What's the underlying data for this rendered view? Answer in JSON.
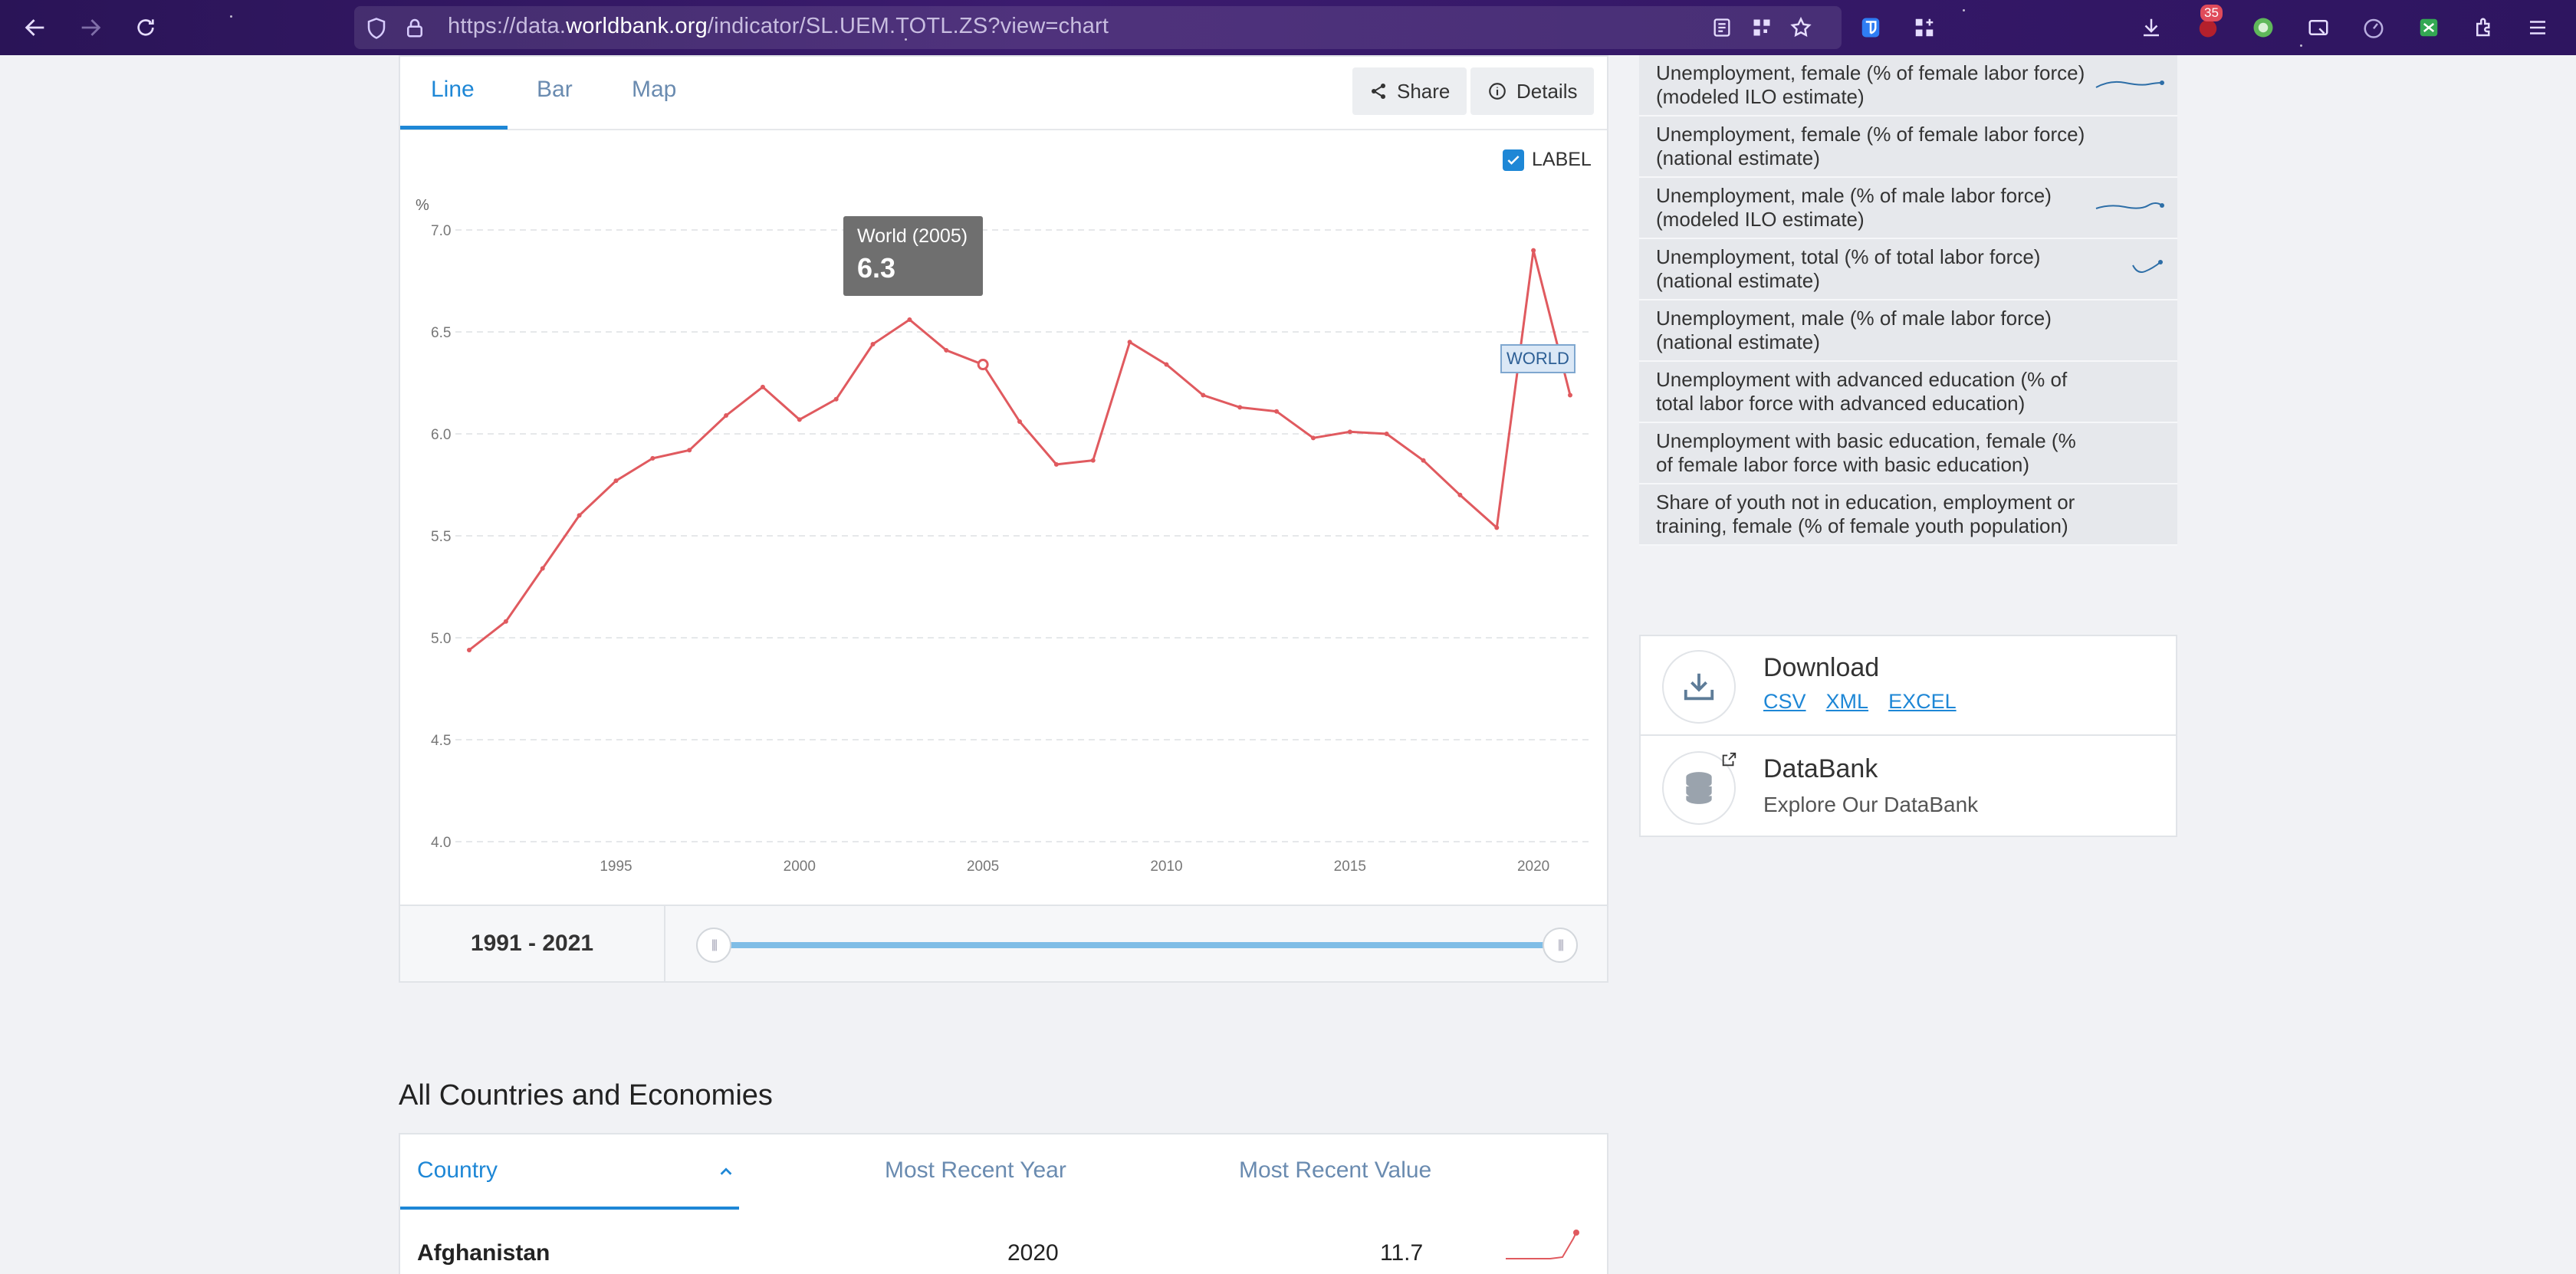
{
  "browser": {
    "url_prefix": "https://data.",
    "url_domain": "worldbank.org",
    "url_path": "/indicator/SL.UEM.TOTL.ZS?view=chart",
    "notification_count": "35"
  },
  "chart_tabs": [
    "Line",
    "Bar",
    "Map"
  ],
  "actions": {
    "share": "Share",
    "details": "Details"
  },
  "label_toggle": "LABEL",
  "tooltip": {
    "title": "World (2005)",
    "value": "6.3"
  },
  "series_tag": "WORLD",
  "chart_data": {
    "type": "line",
    "ylabel": "%",
    "ylim": [
      4.0,
      7.0
    ],
    "yticks": [
      "7.0",
      "6.5",
      "6.0",
      "5.5",
      "5.0",
      "4.5",
      "4.0"
    ],
    "xticks": [
      "1995",
      "2000",
      "2005",
      "2010",
      "2015",
      "2020"
    ],
    "grid": true,
    "color": "#e05a5f",
    "x": [
      1991,
      1992,
      1993,
      1994,
      1995,
      1996,
      1997,
      1998,
      1999,
      2000,
      2001,
      2002,
      2003,
      2004,
      2005,
      2006,
      2007,
      2008,
      2009,
      2010,
      2011,
      2012,
      2013,
      2014,
      2015,
      2016,
      2017,
      2018,
      2019,
      2020,
      2021
    ],
    "values": [
      4.94,
      5.08,
      5.34,
      5.6,
      5.77,
      5.88,
      5.92,
      6.09,
      6.23,
      6.07,
      6.17,
      6.44,
      6.56,
      6.41,
      6.34,
      6.06,
      5.85,
      5.87,
      6.45,
      6.34,
      6.19,
      6.13,
      6.11,
      5.98,
      6.01,
      6.0,
      5.87,
      5.7,
      5.54,
      6.9,
      6.19
    ]
  },
  "range": {
    "label": "1991 - 2021",
    "start_fraction": 0,
    "end_fraction": 1
  },
  "sidebar": {
    "items": [
      "Unemployment, female (% of female labor force) (modeled ILO estimate)",
      "Unemployment, female (% of female labor force) (national estimate)",
      "Unemployment, male (% of male labor force) (modeled ILO estimate)",
      "Unemployment, total (% of total labor force) (national estimate)",
      "Unemployment, male (% of male labor force) (national estimate)",
      "Unemployment with advanced education (% of total labor force with advanced education)",
      "Unemployment with basic education, female (% of female labor force with basic education)",
      "Share of youth not in education, employment or training, female (% of female youth population)"
    ]
  },
  "download": {
    "title": "Download",
    "csv": "CSV",
    "xml": "XML",
    "excel": "EXCEL"
  },
  "databank": {
    "title": "DataBank",
    "subtitle": "Explore Our DataBank"
  },
  "countries": {
    "title": "All Countries and Economies",
    "headers": {
      "country": "Country",
      "year": "Most Recent Year",
      "value": "Most Recent Value"
    },
    "rows": [
      {
        "country": "Afghanistan",
        "year": "2020",
        "value": "11.7"
      }
    ]
  }
}
